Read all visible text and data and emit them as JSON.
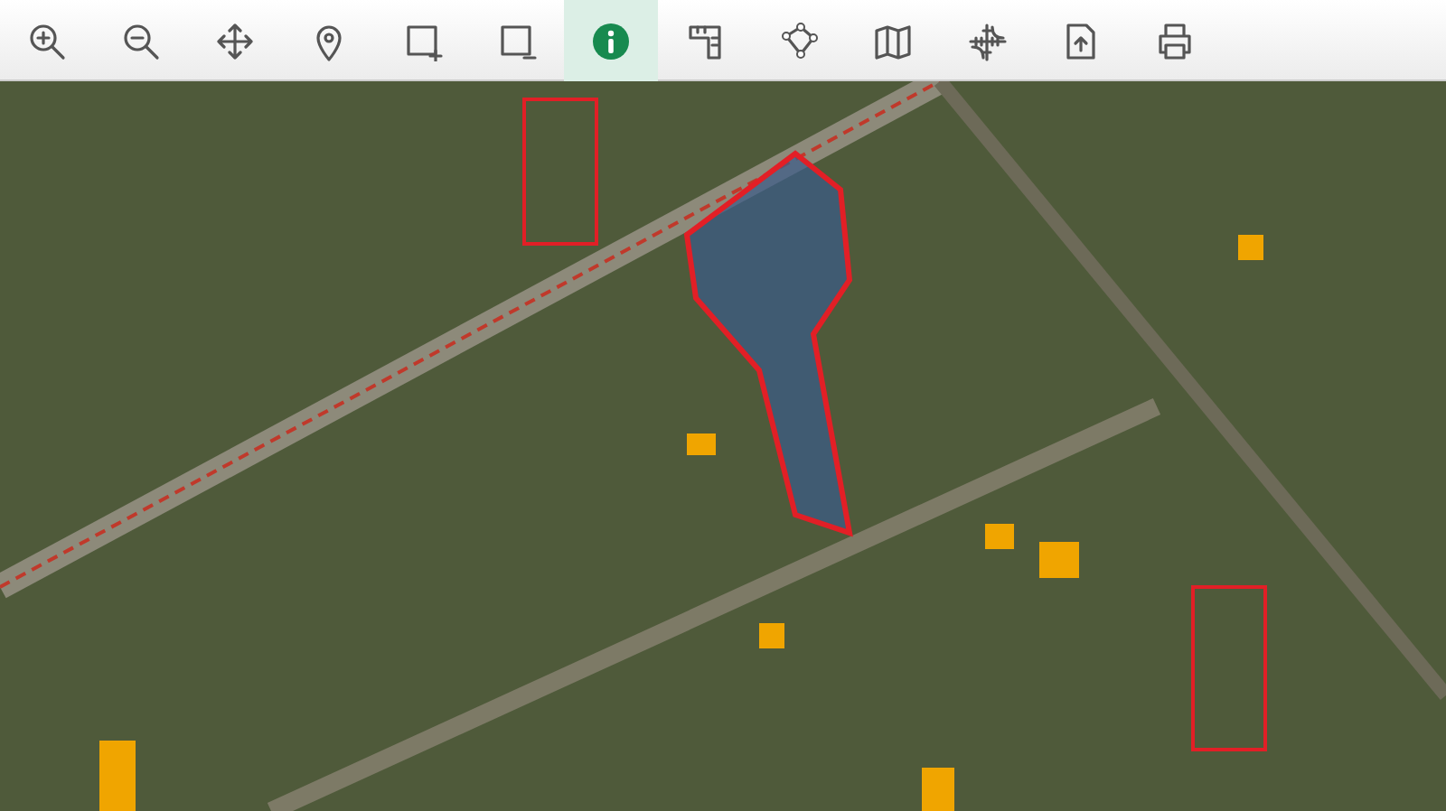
{
  "toolbar": {
    "tools": [
      {
        "kind": "zoom-in",
        "selected": false
      },
      {
        "kind": "zoom-out",
        "selected": false
      },
      {
        "kind": "pan",
        "selected": false
      },
      {
        "kind": "pin",
        "selected": false
      },
      {
        "kind": "select-add",
        "selected": false
      },
      {
        "kind": "select-remove",
        "selected": false
      },
      {
        "kind": "info",
        "selected": true
      },
      {
        "kind": "measure-area",
        "selected": false
      },
      {
        "kind": "polygon",
        "selected": false
      },
      {
        "kind": "map",
        "selected": false
      },
      {
        "kind": "coordinates",
        "selected": false
      },
      {
        "kind": "upload",
        "selected": false
      },
      {
        "kind": "print",
        "selected": false
      }
    ]
  }
}
